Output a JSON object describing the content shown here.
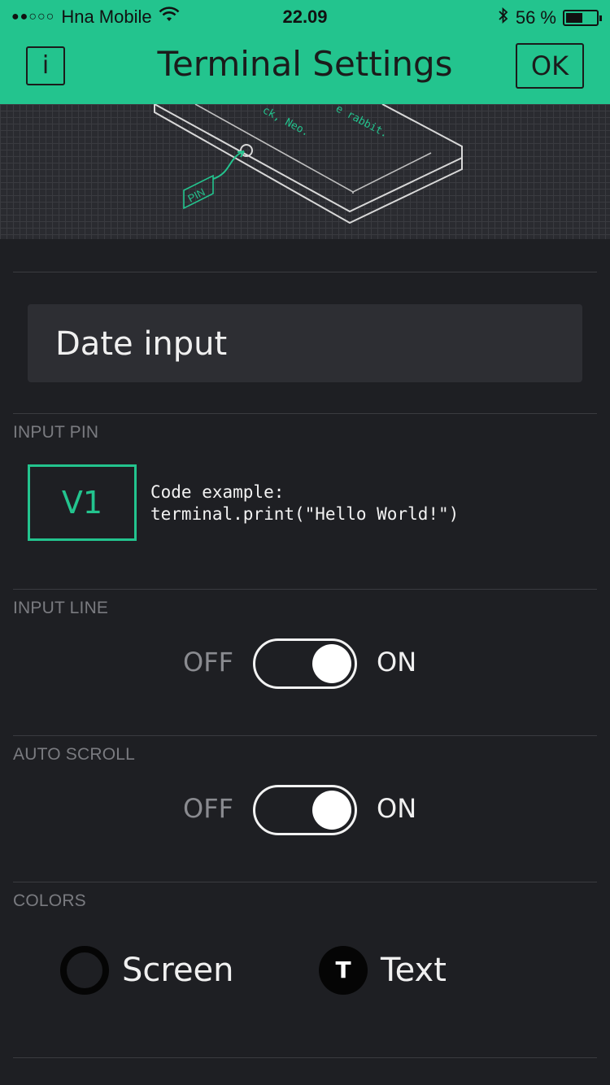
{
  "status_bar": {
    "signal_dots": "●●○○○",
    "carrier": "Hna Mobile",
    "wifi_icon": "wifi-icon",
    "time": "22.09",
    "bluetooth_icon": "bluetooth-icon",
    "battery_percent": "56 %",
    "battery_level": 0.56
  },
  "header": {
    "info_label": "i",
    "title": "Terminal Settings",
    "ok_label": "OK",
    "color": "#23c48e"
  },
  "hero": {
    "pin_tag": "PIN",
    "screen_text_1": "ck, Neo.",
    "screen_text_2": "e rabbit."
  },
  "widget_name": {
    "value": "Date input"
  },
  "input_pin": {
    "label": "INPUT PIN",
    "pin": "V1",
    "code_line1": "Code example:",
    "code_line2": "terminal.print(\"Hello World!\")"
  },
  "input_line": {
    "label": "INPUT LINE",
    "off": "OFF",
    "on": "ON",
    "state": "on"
  },
  "auto_scroll": {
    "label": "AUTO SCROLL",
    "off": "OFF",
    "on": "ON",
    "state": "on"
  },
  "colors": {
    "label": "COLORS",
    "screen_label": "Screen",
    "text_label": "Text",
    "text_badge": "T",
    "screen_color": "#050505",
    "text_color": "#050505"
  }
}
